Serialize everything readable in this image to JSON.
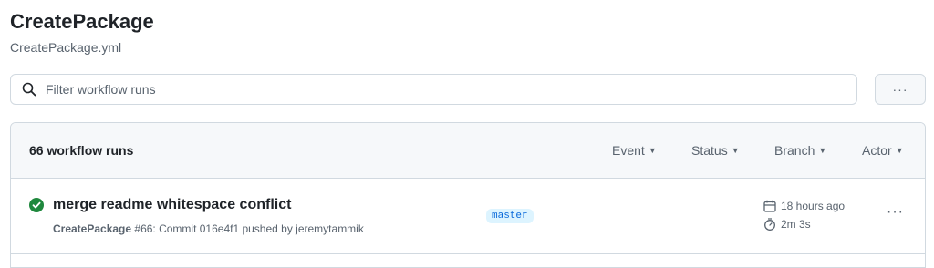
{
  "workflow": {
    "title": "CreatePackage",
    "file": "CreatePackage.yml"
  },
  "filter": {
    "placeholder": "Filter workflow runs",
    "value": ""
  },
  "more_button": {
    "label": "···",
    "icon": "kebab-horizontal-icon"
  },
  "runs_header": {
    "count_label": "66 workflow runs",
    "filters": [
      {
        "label": "Event"
      },
      {
        "label": "Status"
      },
      {
        "label": "Branch"
      },
      {
        "label": "Actor"
      }
    ]
  },
  "runs": [
    {
      "status": "success",
      "status_icon": "check-circle-icon",
      "title": "merge readme whitespace conflict",
      "workflow_name": "CreatePackage",
      "meta_rest": " #66: Commit 016e4f1 pushed by jeremytammik",
      "branch": "master",
      "time_ago": "18 hours ago",
      "duration": "2m 3s",
      "more_label": "···"
    }
  ],
  "colors": {
    "success": "#1f883d",
    "branch_bg": "#ddf4ff",
    "branch_fg": "#0969da",
    "border": "#d1d9e0"
  }
}
